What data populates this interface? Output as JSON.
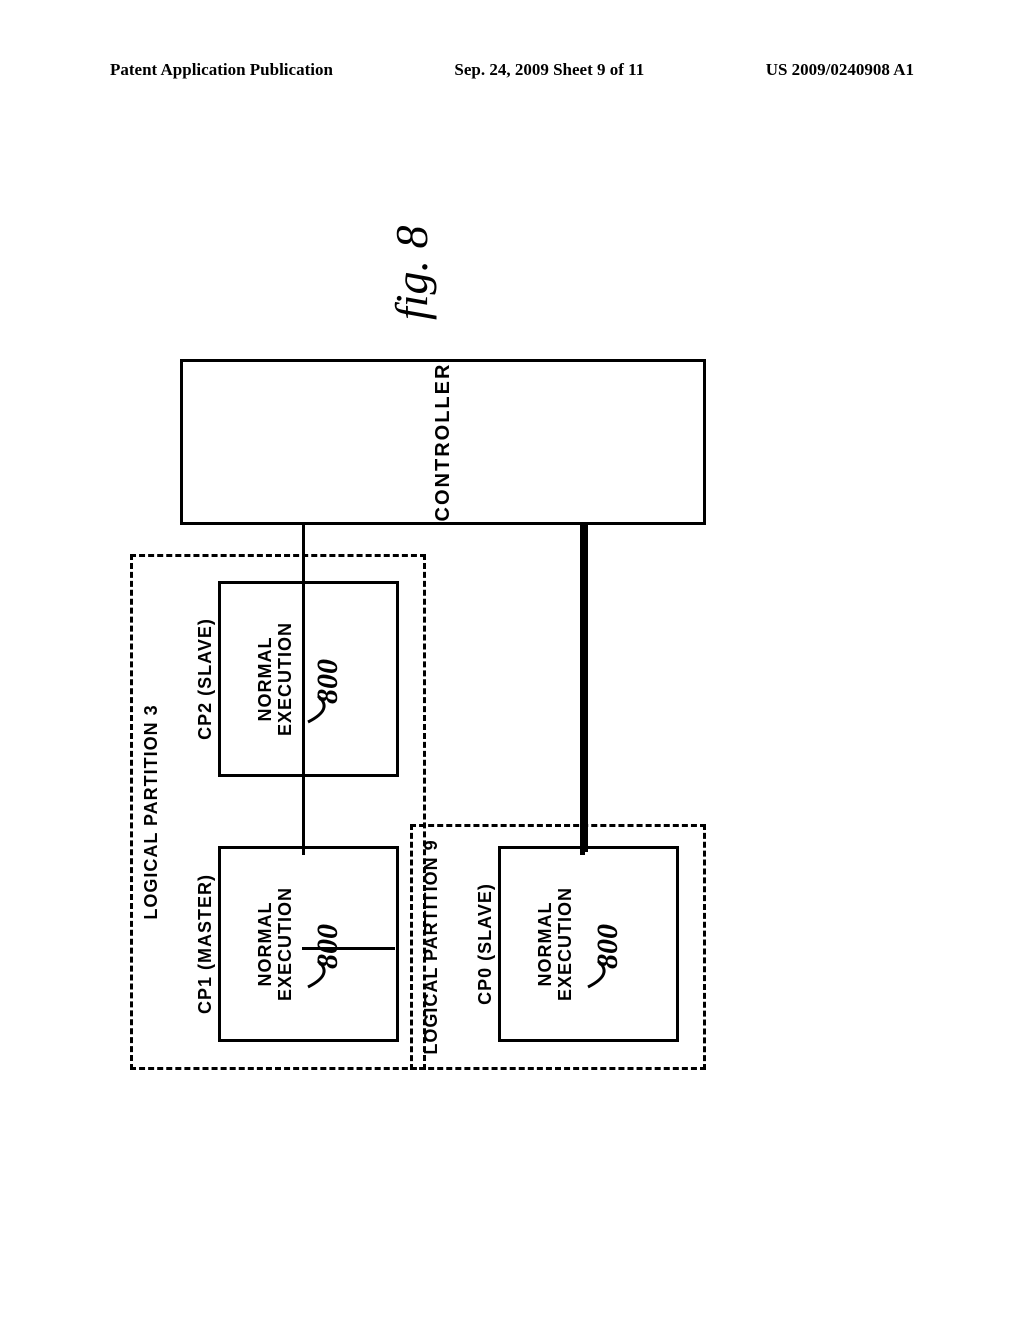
{
  "header": {
    "left": "Patent Application Publication",
    "center": "Sep. 24, 2009 Sheet 9 of 11",
    "right": "US 2009/0240908 A1"
  },
  "figure": {
    "caption": "fig. 8",
    "controller_label": "CONTROLLER",
    "exec_text_line1": "NORMAL",
    "exec_text_line2": "EXECUTION",
    "ref": "800"
  },
  "partitions": {
    "p9": {
      "title_line1": "LOGICAL PARTITION 9",
      "cpu_label": "CP0 (SLAVE)"
    },
    "p3": {
      "title_line1": "LOGICAL PARTITION 3",
      "cpuA_label": "CP1 (MASTER)",
      "cpuB_label": "CP2 (SLAVE)"
    }
  }
}
